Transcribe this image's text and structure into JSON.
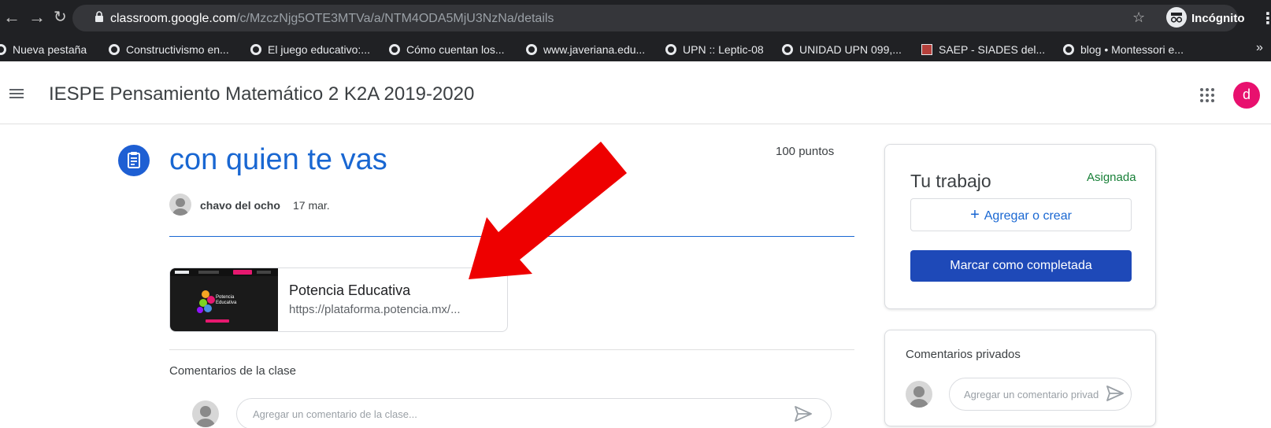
{
  "browser": {
    "url_host": "classroom.google.com",
    "url_path": "/c/MzczNjg5OTE3MTVa/a/NTM4ODA5MjU3NzNa/details",
    "profile_label": "Incógnito",
    "bookmarks": [
      {
        "label": "Nueva pestaña",
        "icon": "globe-icon"
      },
      {
        "label": "Constructivismo en...",
        "icon": "globe-icon"
      },
      {
        "label": "El juego educativo:...",
        "icon": "globe-icon"
      },
      {
        "label": "Cómo cuentan los...",
        "icon": "globe-icon"
      },
      {
        "label": "www.javeriana.edu...",
        "icon": "globe-icon"
      },
      {
        "label": "UPN :: Leptic-08",
        "icon": "globe-icon"
      },
      {
        "label": "UNIDAD UPN 099,...",
        "icon": "globe-icon"
      },
      {
        "label": "SAEP - SIADES del...",
        "icon": "saep-icon"
      },
      {
        "label": "blog • Montessori e...",
        "icon": "globe-icon"
      }
    ],
    "overflow_label": "»"
  },
  "header": {
    "class_title": "IESPE Pensamiento Matemático 2 K2A 2019-2020",
    "avatar_letter": "d",
    "avatar_color": "#e8106e"
  },
  "assignment": {
    "title": "con quien te vas",
    "points": "100 puntos",
    "author": "chavo del ocho",
    "date": "17 mar.",
    "accent_color": "#1967d2"
  },
  "attachment": {
    "title": "Potencia Educativa",
    "url": "https://plataforma.potencia.mx/...",
    "thumb_text_line1": "Potencia",
    "thumb_text_line2": "Educativa"
  },
  "class_comments": {
    "label": "Comentarios de la clase",
    "placeholder": "Agregar un comentario de la clase..."
  },
  "your_work": {
    "title": "Tu trabajo",
    "status": "Asignada",
    "status_color": "#188038",
    "add_label": "Agregar o crear",
    "complete_label": "Marcar como completada"
  },
  "private_comments": {
    "label": "Comentarios privados",
    "placeholder": "Agregar un comentario privado..."
  },
  "annotation": {
    "arrow_color": "#ee0000"
  }
}
